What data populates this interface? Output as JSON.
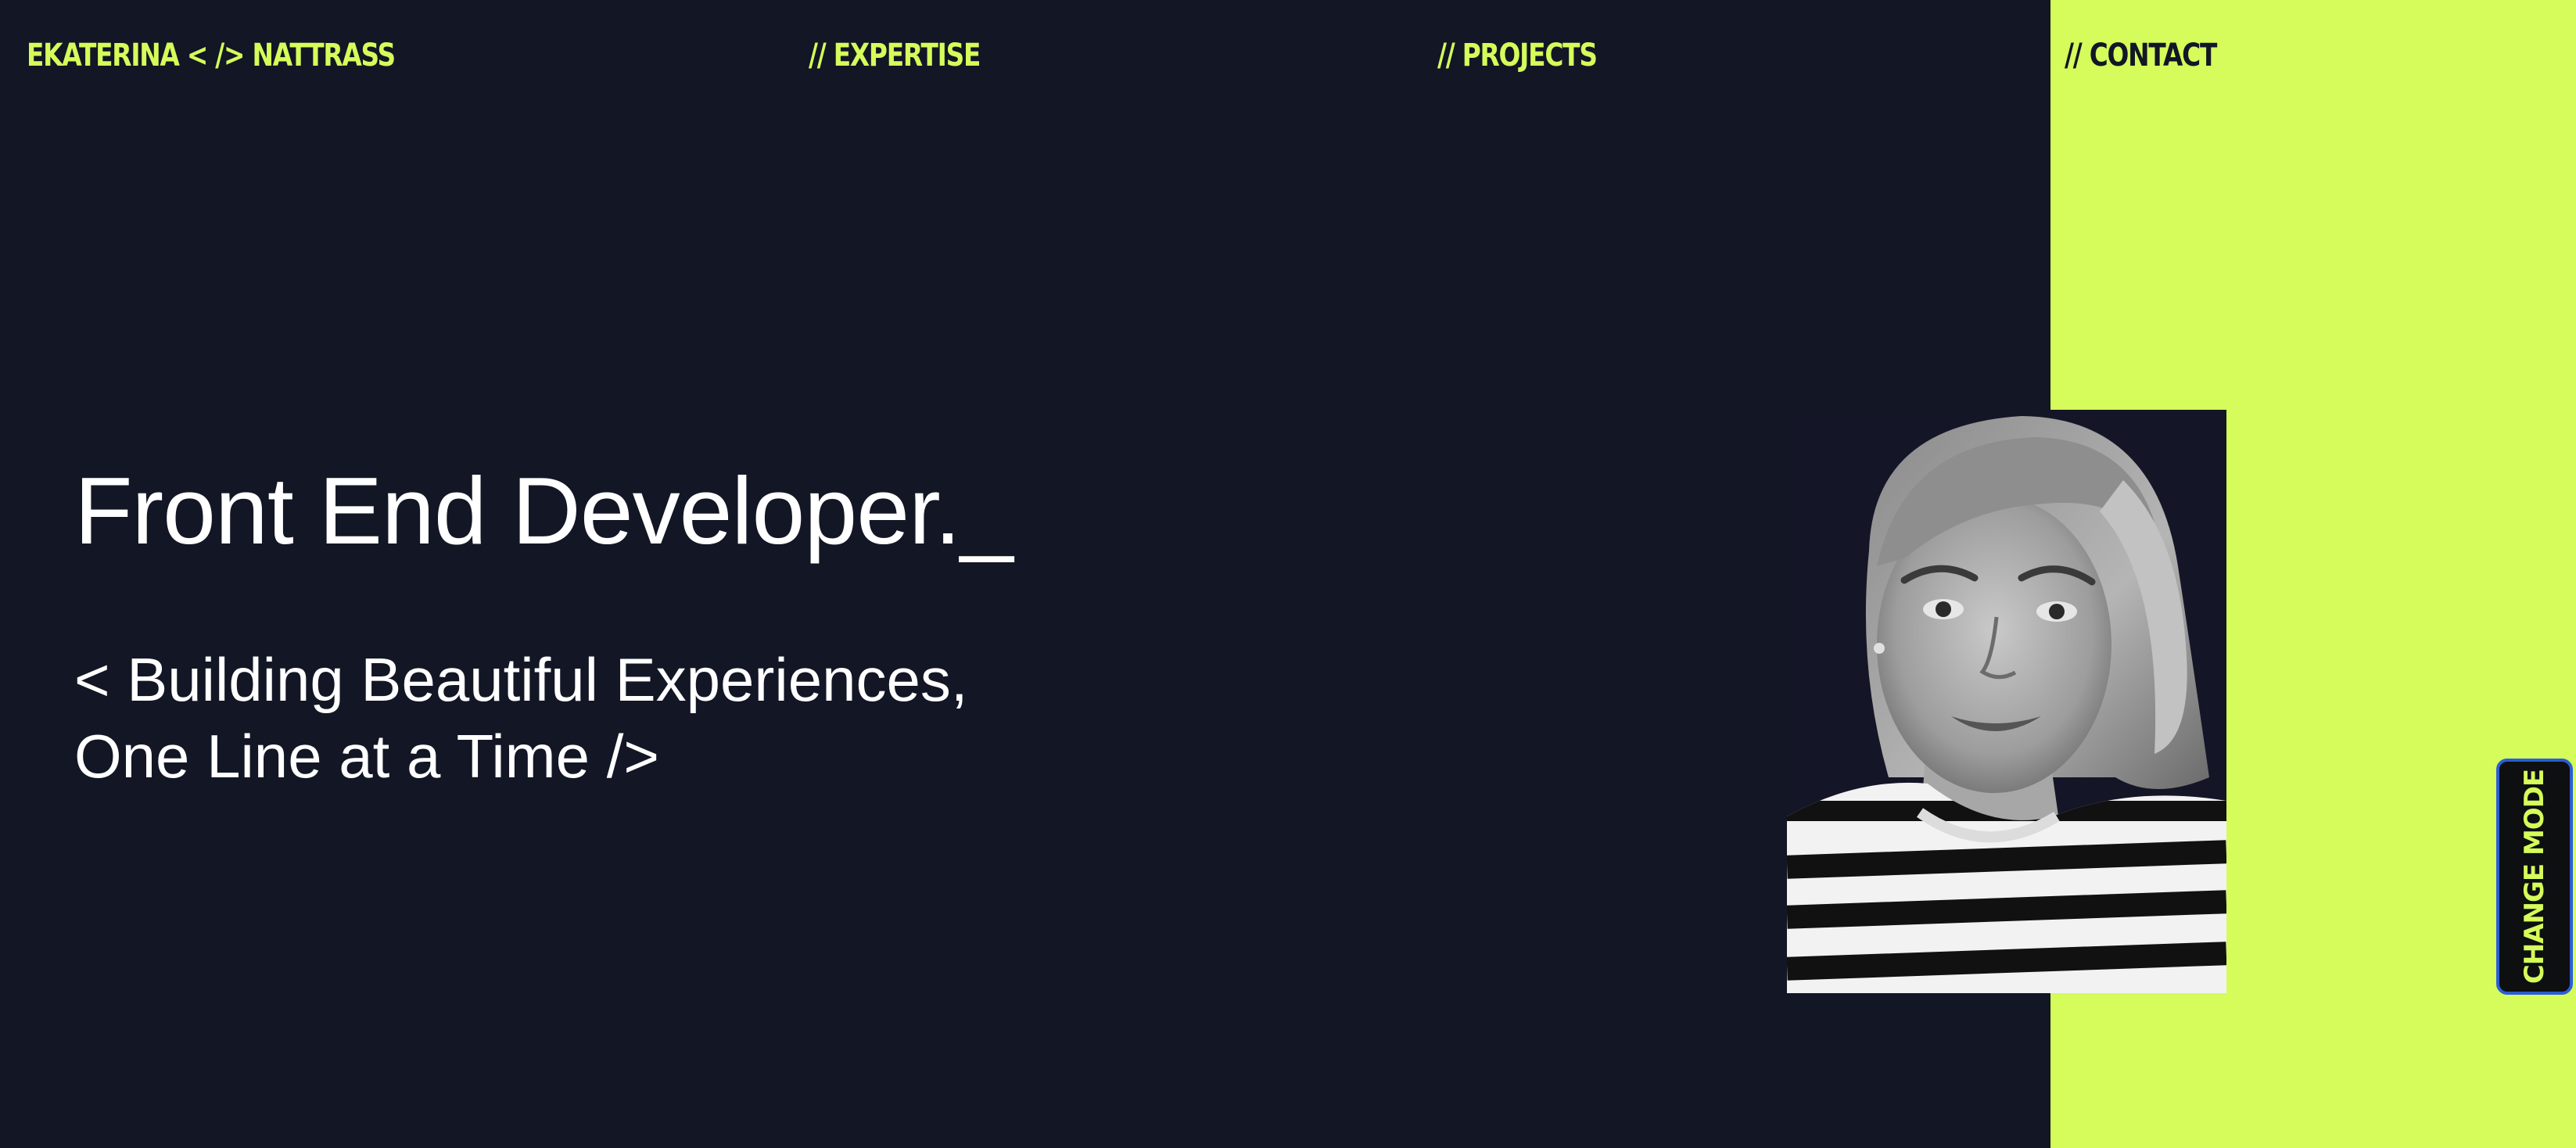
{
  "brand": {
    "name": "EKATERINA < /> NATTRASS"
  },
  "nav": {
    "expertise": "// EXPERTISE",
    "projects": "// PROJECTS",
    "contact": "// CONTACT"
  },
  "hero": {
    "title": "Front End Developer._",
    "subtitle_line1": "< Building Beautiful Experiences,",
    "subtitle_line2": "One Line at a Time />"
  },
  "portrait": {
    "alt": "portrait-photo"
  },
  "mode_toggle": {
    "label": "CHANGE MODE"
  },
  "colors": {
    "background": "#131625",
    "accent": "#d5fc5a",
    "text": "#ffffff",
    "button_border": "#2b5dd6"
  }
}
